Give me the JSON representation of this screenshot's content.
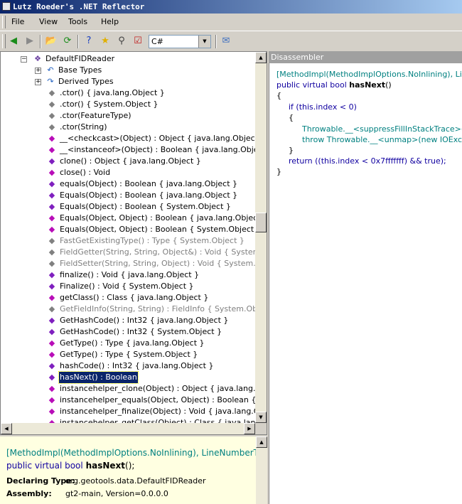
{
  "window": {
    "title": "Lutz Roeder's .NET Reflector"
  },
  "menu": [
    "File",
    "View",
    "Tools",
    "Help"
  ],
  "toolbar": {
    "buttons": [
      "back-icon",
      "forward-icon",
      "open-icon",
      "refresh-icon",
      "search-help-icon",
      "favorite-icon",
      "search-icon",
      "bookmark-icon"
    ],
    "language": "C#"
  },
  "tree": {
    "root": "DefaultFIDReader",
    "base_types": "Base Types",
    "derived_types": "Derived Types",
    "members": [
      {
        "label": ".ctor() { java.lang.Object }",
        "kind": "ctor",
        "gray": false
      },
      {
        "label": ".ctor() { System.Object }",
        "kind": "ctor",
        "gray": false
      },
      {
        "label": ".ctor(FeatureType)",
        "kind": "ctor",
        "gray": false
      },
      {
        "label": ".ctor(String)",
        "kind": "ctor",
        "gray": false
      },
      {
        "label": "__<checkcast>(Object) : Object { java.lang.Object }",
        "kind": "method",
        "gray": false
      },
      {
        "label": "__<instanceof>(Object) : Boolean { java.lang.Object }",
        "kind": "method",
        "gray": false
      },
      {
        "label": "clone() : Object { java.lang.Object }",
        "kind": "virt",
        "gray": false
      },
      {
        "label": "close() : Void",
        "kind": "method",
        "gray": false
      },
      {
        "label": "equals(Object) : Boolean { java.lang.Object }",
        "kind": "virt",
        "gray": false
      },
      {
        "label": "Equals(Object) : Boolean { java.lang.Object }",
        "kind": "virt",
        "gray": false
      },
      {
        "label": "Equals(Object) : Boolean { System.Object }",
        "kind": "virt",
        "gray": false
      },
      {
        "label": "Equals(Object, Object) : Boolean { java.lang.Object }",
        "kind": "method",
        "gray": false
      },
      {
        "label": "Equals(Object, Object) : Boolean { System.Object }",
        "kind": "method",
        "gray": false
      },
      {
        "label": "FastGetExistingType() : Type { System.Object }",
        "kind": "lock",
        "gray": true
      },
      {
        "label": "FieldGetter(String, String, Object&) : Void { System.Object",
        "kind": "lock",
        "gray": true
      },
      {
        "label": "FieldSetter(String, String, Object) : Void { System.Object",
        "kind": "lock",
        "gray": true
      },
      {
        "label": "finalize() : Void { java.lang.Object }",
        "kind": "virt",
        "gray": false
      },
      {
        "label": "Finalize() : Void { System.Object }",
        "kind": "virt",
        "gray": false
      },
      {
        "label": "getClass() : Class { java.lang.Object }",
        "kind": "method",
        "gray": false
      },
      {
        "label": "GetFieldInfo(String, String) : FieldInfo { System.Object }",
        "kind": "lock",
        "gray": true
      },
      {
        "label": "GetHashCode() : Int32 { java.lang.Object }",
        "kind": "virt",
        "gray": false
      },
      {
        "label": "GetHashCode() : Int32 { System.Object }",
        "kind": "virt",
        "gray": false
      },
      {
        "label": "GetType() : Type { java.lang.Object }",
        "kind": "method",
        "gray": false
      },
      {
        "label": "GetType() : Type { System.Object }",
        "kind": "method",
        "gray": false
      },
      {
        "label": "hashCode() : Int32 { java.lang.Object }",
        "kind": "virt",
        "gray": false
      },
      {
        "label": "hasNext() : Boolean",
        "kind": "virt",
        "gray": false,
        "selected": true
      },
      {
        "label": "instancehelper_clone(Object) : Object { java.lang.Object",
        "kind": "method",
        "gray": false
      },
      {
        "label": "instancehelper_equals(Object, Object) : Boolean { java.la",
        "kind": "method",
        "gray": false
      },
      {
        "label": "instancehelper_finalize(Object) : Void { java.lang.Object",
        "kind": "method",
        "gray": false
      },
      {
        "label": "instancehelper_getClass(Object) : Class { java.lang.Obje",
        "kind": "method",
        "gray": false
      }
    ]
  },
  "disassembler": {
    "header": "Disassembler",
    "attr_line": "[MethodImpl(MethodImplOptions.NoInlining), LineNumber",
    "sig_prefix": "public virtual bool ",
    "sig_name": "hasNext",
    "sig_suffix": "()",
    "open_brace": "{",
    "if_line": "if (this.index < 0)",
    "inner_open": "{",
    "throw_line1": "Throwable.__<suppressFillInStackTrace>();",
    "throw_line2": "throw Throwable.__<unmap>(new IOExceptio",
    "inner_close": "}",
    "return_line": "return ((this.index < 0x7fffffff) && true);",
    "close_brace": "}"
  },
  "info": {
    "attr_line": "[MethodImpl(MethodImplOptions.NoInlining), LineNumberTab",
    "sig_prefix": "public virtual bool ",
    "sig_name": "hasNext",
    "sig_suffix": "();",
    "declaring_type_key": "Declaring Type:",
    "declaring_type_value": "org.geotools.data.DefaultFIDReader",
    "assembly_key": "Assembly:",
    "assembly_value": "gt2-main, Version=0.0.0.0"
  }
}
